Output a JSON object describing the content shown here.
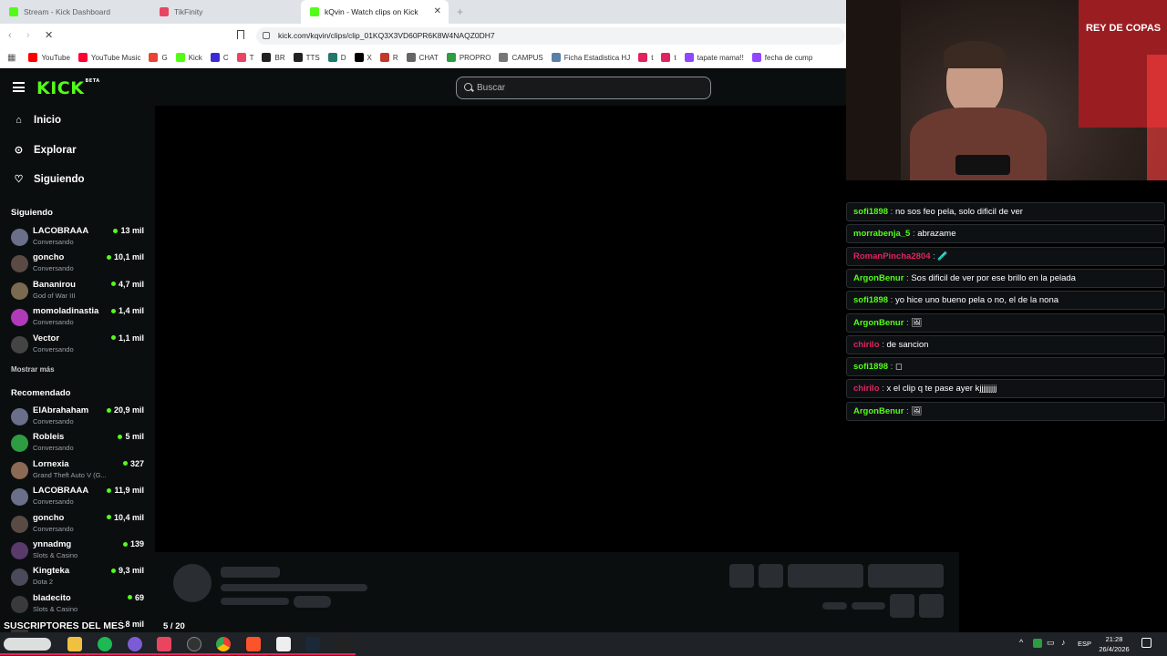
{
  "browser": {
    "tabs": [
      {
        "label": "Stream - Kick Dashboard",
        "color": "#53fc18"
      },
      {
        "label": "TikFinity",
        "color": "#e94560"
      },
      {
        "label": "kQvin - Watch clips on Kick",
        "color": "#53fc18"
      }
    ],
    "url": "kick.com/kqvin/clips/clip_01KQ3X3VD60PR6K8W4NAQZ0DH7",
    "bookmarks": [
      {
        "label": "YouTube",
        "color": "#ff0000"
      },
      {
        "label": "YouTube Music",
        "color": "#ff0033"
      },
      {
        "label": "G",
        "color": "#ea4335"
      },
      {
        "label": "Kick",
        "color": "#53fc18"
      },
      {
        "label": "C",
        "color": "#3b2bd6"
      },
      {
        "label": "T",
        "color": "#e94560"
      },
      {
        "label": "BR",
        "color": "#222222"
      },
      {
        "label": "TTS",
        "color": "#222222"
      },
      {
        "label": "D",
        "color": "#1f7a6b"
      },
      {
        "label": "X",
        "color": "#000000"
      },
      {
        "label": "R",
        "color": "#c0392b"
      },
      {
        "label": "CHAT",
        "color": "#666666"
      },
      {
        "label": "PROPRO",
        "color": "#2e9c42"
      },
      {
        "label": "CAMPUS",
        "color": "#777777"
      },
      {
        "label": "Ficha Estadistica HJ",
        "color": "#5b7fa6"
      },
      {
        "label": "t",
        "color": "#e0245e"
      },
      {
        "label": "t",
        "color": "#e0245e"
      },
      {
        "label": "tapate mama!!",
        "color": "#9146ff"
      },
      {
        "label": "fecha de cump",
        "color": "#9146ff"
      }
    ]
  },
  "kick": {
    "logo": "KICK",
    "logo_badge": "BETA",
    "search_placeholder": "Buscar",
    "nav": [
      {
        "label": "Inicio",
        "icon": "home-icon"
      },
      {
        "label": "Explorar",
        "icon": "compass-icon"
      },
      {
        "label": "Siguiendo",
        "icon": "heart-icon"
      }
    ],
    "following_title": "Siguiendo",
    "following": [
      {
        "name": "LACOBRAAA",
        "category": "Conversando",
        "viewers": "13 mil",
        "avatar": "#6a6f8a"
      },
      {
        "name": "goncho",
        "category": "Conversando",
        "viewers": "10,1 mil",
        "avatar": "#5a4a44"
      },
      {
        "name": "Bananirou",
        "category": "God of War III",
        "viewers": "4,7 mil",
        "avatar": "#7a6a50"
      },
      {
        "name": "momoladinastia",
        "category": "Conversando",
        "viewers": "1,4 mil",
        "avatar": "#b03ab8"
      },
      {
        "name": "Vector",
        "category": "Conversando",
        "viewers": "1,1 mil",
        "avatar": "#444444"
      }
    ],
    "show_more": "Mostrar más",
    "recommended_title": "Recomendado",
    "recommended": [
      {
        "name": "ElAbrahaham",
        "category": "Conversando",
        "viewers": "20,9 mil",
        "avatar": "#6a6f8a"
      },
      {
        "name": "Robleis",
        "category": "Conversando",
        "viewers": "5 mil",
        "avatar": "#2e9c42"
      },
      {
        "name": "Lornexia",
        "category": "Grand Theft Auto V (G...",
        "viewers": "327",
        "avatar": "#8a6a55"
      },
      {
        "name": "LACOBRAAA",
        "category": "Conversando",
        "viewers": "11,9 mil",
        "avatar": "#6a6f8a"
      },
      {
        "name": "goncho",
        "category": "Conversando",
        "viewers": "10,4 mil",
        "avatar": "#5a4a44"
      },
      {
        "name": "ynnadmg",
        "category": "Slots & Casino",
        "viewers": "139",
        "avatar": "#5a3a6a"
      },
      {
        "name": "Kingteka",
        "category": "Dota 2",
        "viewers": "9,3 mil",
        "avatar": "#4a4a5a"
      },
      {
        "name": "bladecito",
        "category": "Slots & Casino",
        "viewers": "69",
        "avatar": "#3a3a3a"
      },
      {
        "name": "",
        "category": "",
        "viewers": "1,8 mil",
        "avatar": "#333333"
      }
    ]
  },
  "chat": [
    {
      "user": "sofi1898",
      "color": "#53fc18",
      "text": "no sos feo pela, solo dificil de ver"
    },
    {
      "user": "morrabenja_5",
      "color": "#53fc18",
      "text": "abrazame"
    },
    {
      "user": "RomanPincha2804",
      "color": "#e0245e",
      "text": "🧪"
    },
    {
      "user": "ArgonBenur",
      "color": "#53fc18",
      "text": "Sos dificil de ver por ese brillo en la pelada"
    },
    {
      "user": "sofi1898",
      "color": "#53fc18",
      "text": "yo hice uno bueno pela o no, el de la nona"
    },
    {
      "user": "ArgonBenur",
      "color": "#53fc18",
      "text": "🖼"
    },
    {
      "user": "chirilo",
      "color": "#e0245e",
      "text": "de sancion"
    },
    {
      "user": "sofi1898",
      "color": "#53fc18",
      "text": "◻"
    },
    {
      "user": "chirilo",
      "color": "#e0245e",
      "text": "x el clip q te pase ayer kjjjjjjjjj"
    },
    {
      "user": "ArgonBenur",
      "color": "#53fc18",
      "text": "🖼"
    }
  ],
  "overlay": {
    "subs_title": "SUSCRIPTORES DEL MES",
    "page": "5 / 20"
  },
  "taskbar": {
    "lang": "ESP",
    "time": "21:28",
    "date": "26/4/2026"
  }
}
